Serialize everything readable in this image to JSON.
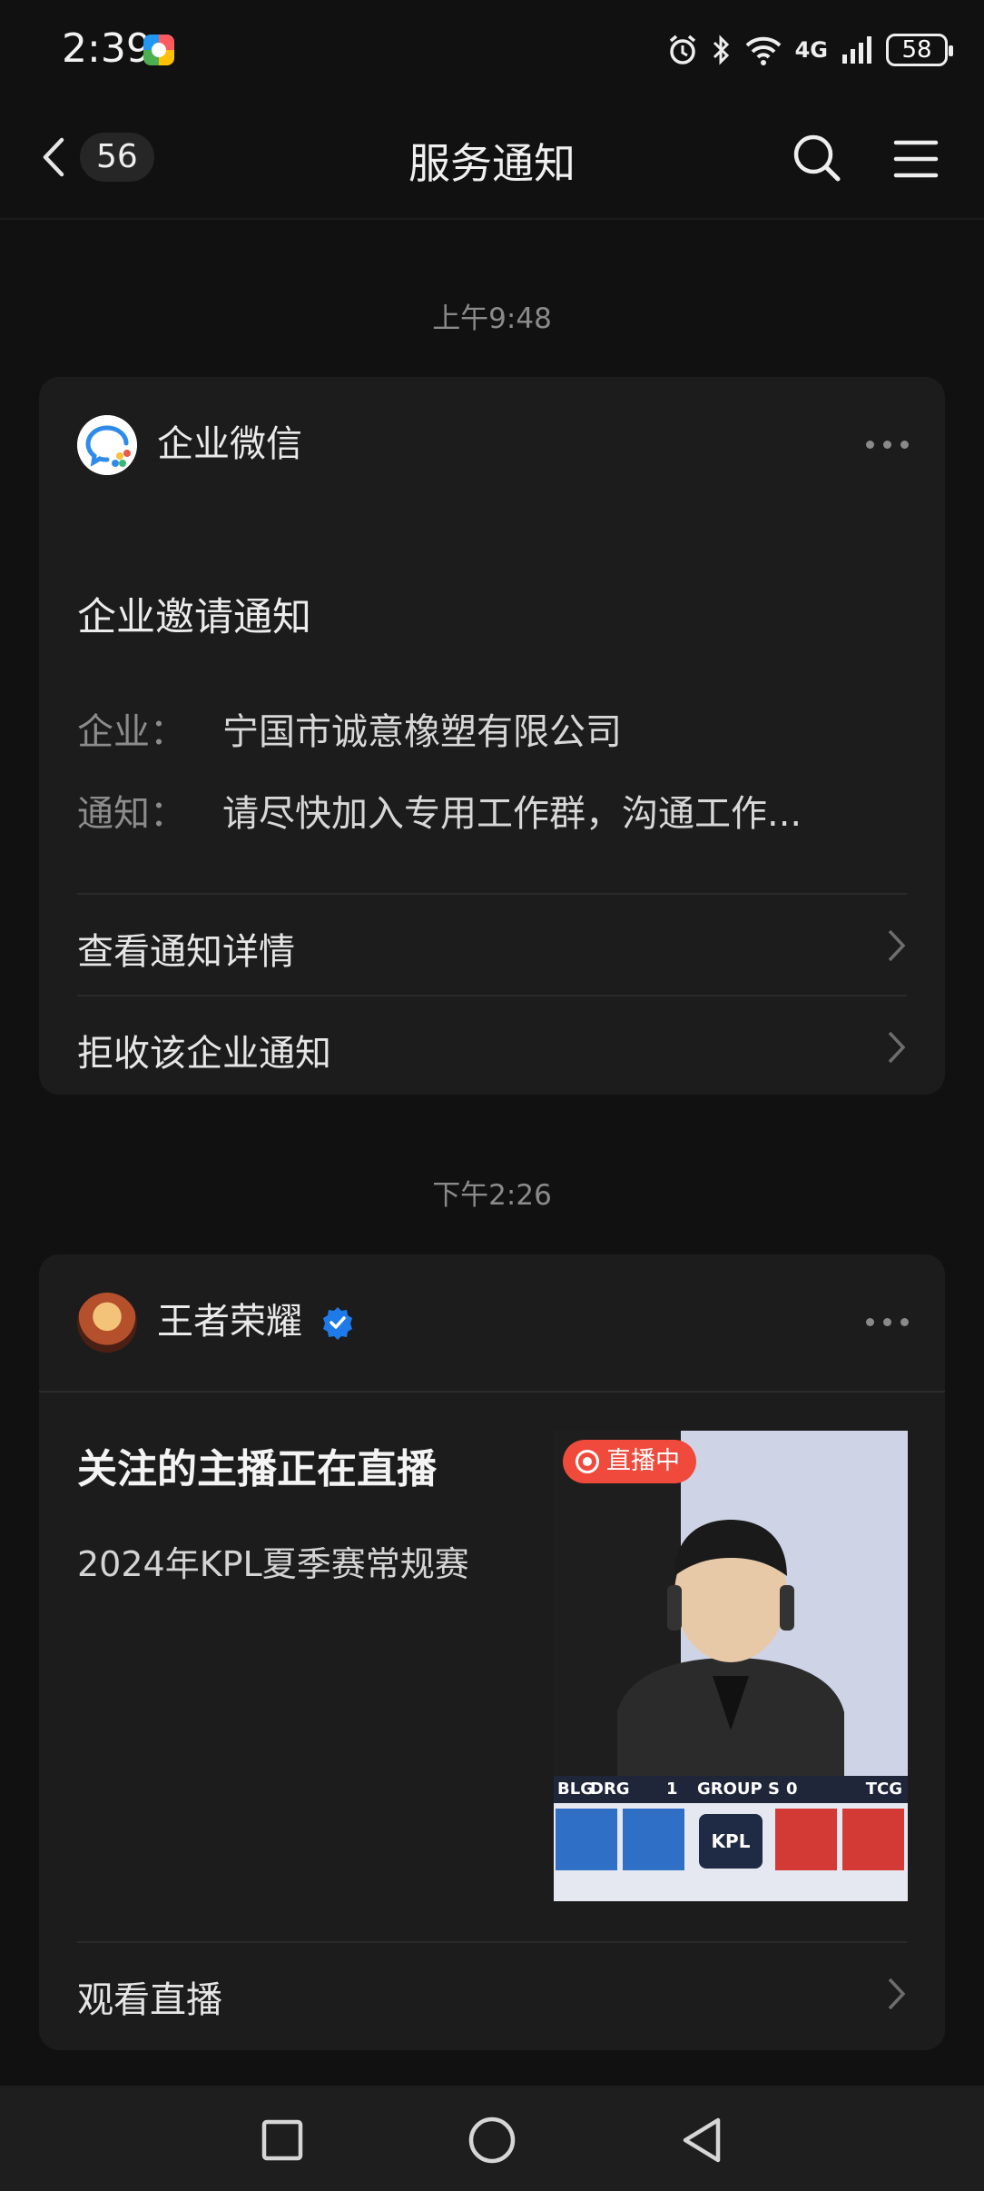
{
  "status_bar": {
    "time": "2:39",
    "network": "4G",
    "battery": "58"
  },
  "nav": {
    "back_count": "56",
    "title": "服务通知"
  },
  "messages": [
    {
      "timestamp": "上午9:48",
      "sender": "企业微信",
      "title": "企业邀请通知",
      "fields": [
        {
          "key": "企业：",
          "value": "宁国市诚意橡塑有限公司"
        },
        {
          "key": "通知：",
          "value": "请尽快加入专用工作群，沟通工作..."
        }
      ],
      "actions": [
        {
          "label": "查看通知详情"
        },
        {
          "label": "拒收该企业通知"
        }
      ]
    },
    {
      "timestamp": "下午2:26",
      "sender": "王者荣耀",
      "verified": true,
      "title": "关注的主播正在直播",
      "subtitle": "2024年KPL夏季赛常规赛",
      "thumbnail": {
        "badge": "直播中",
        "score_left_team": "BLG",
        "score_left_team2": "DRG",
        "score_left": "1",
        "group": "GROUP S",
        "score_right": "0",
        "score_right_team": "TCG",
        "logo_text": "KPL"
      },
      "actions": [
        {
          "label": "观看直播"
        }
      ]
    }
  ],
  "colors": {
    "background": "#111111",
    "card": "#1c1c1c",
    "live_red": "#ef4a3c",
    "verified_blue": "#1e7ae8"
  }
}
